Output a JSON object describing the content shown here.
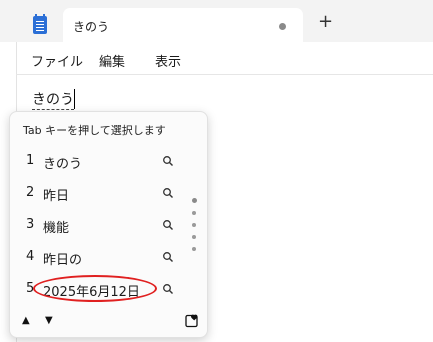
{
  "tab": {
    "title": "きのう"
  },
  "menu": {
    "file": "ファイル",
    "edit": "編集",
    "view": "表示"
  },
  "editor": {
    "text": "きのう"
  },
  "ime": {
    "header": "Tab キーを押して選択します",
    "candidates": [
      {
        "num": "1",
        "text": "きのう"
      },
      {
        "num": "2",
        "text": "昨日"
      },
      {
        "num": "3",
        "text": "機能"
      },
      {
        "num": "4",
        "text": "昨日の"
      },
      {
        "num": "5",
        "text": "2025年6月12日"
      }
    ]
  },
  "colors": {
    "highlight": "#e02020",
    "accent": "#2b6fd6"
  },
  "icons": [
    "notepad-icon",
    "search-icon",
    "up-arrow-icon",
    "down-arrow-icon",
    "favorite-icon"
  ]
}
